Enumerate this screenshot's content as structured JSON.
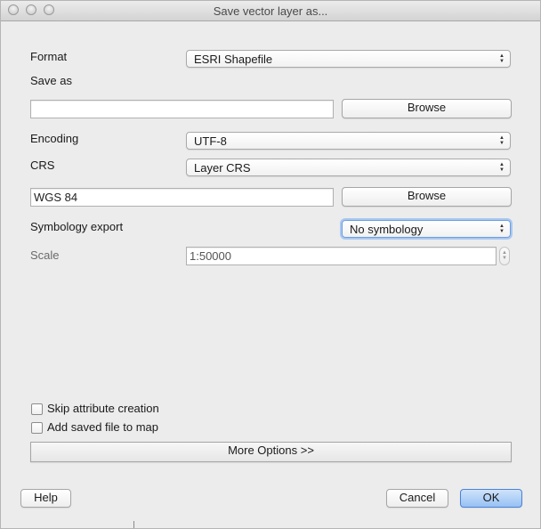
{
  "window": {
    "title": "Save vector layer as..."
  },
  "form": {
    "format": {
      "label": "Format",
      "value": "ESRI Shapefile"
    },
    "save_as": {
      "label": "Save as",
      "value": "",
      "browse_label": "Browse"
    },
    "encoding": {
      "label": "Encoding",
      "value": "UTF-8"
    },
    "crs": {
      "label": "CRS",
      "value": "Layer CRS",
      "crs_value": "WGS 84",
      "browse_label": "Browse"
    },
    "symbology_export": {
      "label": "Symbology export",
      "value": "No symbology"
    },
    "scale": {
      "label": "Scale",
      "value": "1:50000"
    }
  },
  "options": {
    "skip_attribute_creation": {
      "label": "Skip attribute creation",
      "checked": false
    },
    "add_saved_file_to_map": {
      "label": "Add saved file to map",
      "checked": false
    },
    "more_options_label": "More Options >>"
  },
  "footer": {
    "help_label": "Help",
    "cancel_label": "Cancel",
    "ok_label": "OK"
  },
  "icons": {
    "select_arrows": "updown-arrows-icon",
    "spinner_arrows": "spinner-arrows-icon"
  },
  "colors": {
    "window_bg": "#ececec",
    "focus_ring": "#a9c8f1",
    "default_button": "#97c1f4"
  }
}
